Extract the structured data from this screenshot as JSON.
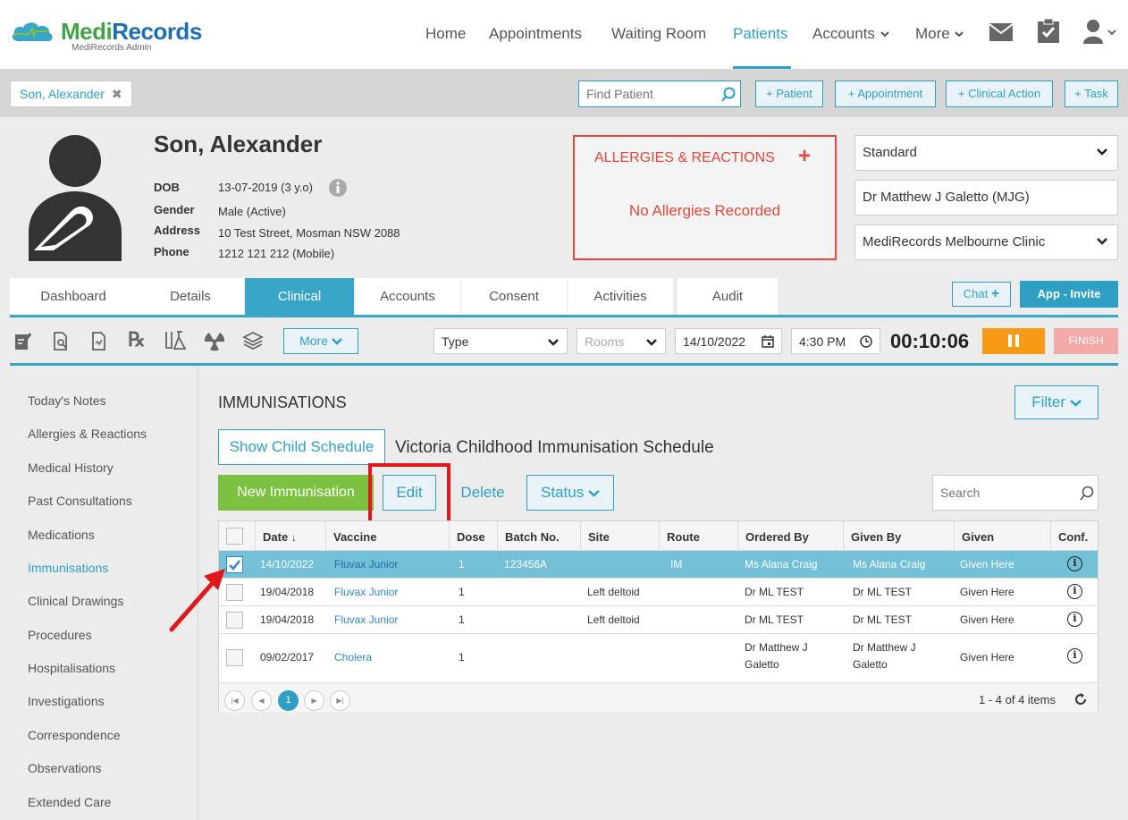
{
  "brand": {
    "name_medi": "Medi",
    "name_records": "Records",
    "subtitle": "MediRecords Admin"
  },
  "nav": {
    "items": [
      "Home",
      "Appointments",
      "Waiting Room",
      "Patients",
      "Accounts",
      "More"
    ],
    "active": "Patients"
  },
  "subbar": {
    "patient_chip": "Son, Alexander",
    "find_placeholder": "Find Patient",
    "buttons": [
      "+ Patient",
      "+ Appointment",
      "+ Clinical Action",
      "+ Task"
    ]
  },
  "patient": {
    "name": "Son, Alexander",
    "dob_label": "DOB",
    "dob": "13-07-2019 (3 y.o)",
    "gender_label": "Gender",
    "gender": "Male (Active)",
    "address_label": "Address",
    "address": "10 Test Street, Mosman NSW 2088",
    "phone_label": "Phone",
    "phone": "1212 121 212 (Mobile)"
  },
  "allergies": {
    "title": "ALLERGIES & REACTIONS",
    "status": "No Allergies Recorded"
  },
  "selectors": {
    "template": "Standard",
    "doctor": "Dr Matthew J Galetto (MJG)",
    "clinic": "MediRecords Melbourne Clinic"
  },
  "tabs": [
    "Dashboard",
    "Details",
    "Clinical",
    "Accounts",
    "Consent",
    "Activities",
    "Audit"
  ],
  "active_tab": "Clinical",
  "chat_label": "Chat",
  "app_invite_label": "App - Invite",
  "toolbar": {
    "more_label": "More",
    "type_label": "Type",
    "rooms_label": "Rooms",
    "date": "14/10/2022",
    "time": "4:30 PM",
    "timer": "00:10:06",
    "finish_label": "FINISH"
  },
  "sidebar": [
    "Today's Notes",
    "Allergies & Reactions",
    "Medical History",
    "Past Consultations",
    "Medications",
    "Immunisations",
    "Clinical Drawings",
    "Procedures",
    "Hospitalisations",
    "Investigations",
    "Correspondence",
    "Observations",
    "Extended Care"
  ],
  "sidebar_active": "Immunisations",
  "immunisations": {
    "title": "IMMUNISATIONS",
    "filter_label": "Filter",
    "show_child_label": "Show Child Schedule",
    "schedule_name": "Victoria Childhood Immunisation Schedule",
    "new_label": "New Immunisation",
    "edit_label": "Edit",
    "delete_label": "Delete",
    "status_label": "Status",
    "search_placeholder": "Search",
    "columns": [
      "Date",
      "Vaccine",
      "Dose",
      "Batch No.",
      "Site",
      "Route",
      "Ordered By",
      "Given By",
      "Given",
      "Conf."
    ],
    "rows": [
      {
        "date": "14/10/2022",
        "vaccine": "Fluvax Junior",
        "dose": "1",
        "batch": "123456A",
        "site": "",
        "route": "IM",
        "ordered_by": "Ms Alana Craig",
        "ordered_by2": "",
        "given_by": "Ms Alana Craig",
        "given_by2": "",
        "given": "Given Here",
        "selected": true
      },
      {
        "date": "19/04/2018",
        "vaccine": "Fluvax Junior",
        "dose": "1",
        "batch": "",
        "site": "Left deltoid",
        "route": "",
        "ordered_by": "Dr ML TEST",
        "ordered_by2": "",
        "given_by": "Dr ML TEST",
        "given_by2": "",
        "given": "Given Here",
        "selected": false
      },
      {
        "date": "19/04/2018",
        "vaccine": "Fluvax Junior",
        "dose": "1",
        "batch": "",
        "site": "Left deltoid",
        "route": "",
        "ordered_by": "Dr ML TEST",
        "ordered_by2": "",
        "given_by": "Dr ML TEST",
        "given_by2": "",
        "given": "Given Here",
        "selected": false
      },
      {
        "date": "09/02/2017",
        "vaccine": "Cholera",
        "dose": "1",
        "batch": "",
        "site": "",
        "route": "",
        "ordered_by": "Dr Matthew J",
        "ordered_by2": "Galetto",
        "given_by": "Dr Matthew J",
        "given_by2": "Galetto",
        "given": "Given Here",
        "selected": false
      }
    ],
    "page": "1",
    "items_count": "1 - 4 of 4 items"
  },
  "colors": {
    "accent": "#2fa0c4",
    "alert": "#e8463c",
    "green": "#7cc142",
    "orange": "#f79a16"
  }
}
